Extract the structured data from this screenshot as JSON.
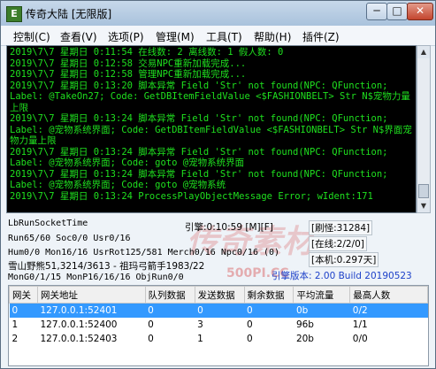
{
  "window": {
    "title": "传奇大陆 [无限版]",
    "icon_name": "app-icon",
    "icon_glyph": "E",
    "minimize_glyph": "─",
    "maximize_glyph": "□",
    "close_glyph": "✕"
  },
  "menu": [
    "控制(C)",
    "查看(V)",
    "选项(P)",
    "管理(M)",
    "工具(T)",
    "帮助(H)",
    "插件(Z)"
  ],
  "log_lines": [
    "2019\\7\\7 星期日 0:11:54 在线数: 2 离线数: 1 假人数: 0",
    "2019\\7\\7 星期日 0:12:58 交易NPC重新加载完成...",
    "2019\\7\\7 星期日 0:12:58 管理NPC重新加载完成...",
    "2019\\7\\7 星期日 0:13:20 脚本异常 Field 'Str' not found(NPC: QFunction;",
    "Label: @TakeOn27; Code: GetDBItemFieldValue <$FASHIONBELT> Str N$宠物力量上限",
    "2019\\7\\7 星期日 0:13:24 脚本异常 Field 'Str' not found(NPC: QFunction;",
    "Label: @宠物系统界面; Code: GetDBItemFieldValue <$FASHIONBELT> Str N$界面宠物力量上限",
    "2019\\7\\7 星期日 0:13:24 脚本异常 Field 'Str' not found(NPC: QFunction;",
    "Label: @宠物系统界面; Code: goto @宠物系统界面",
    "2019\\7\\7 星期日 0:13:24 脚本异常 Field 'Str' not found(NPC: QFunction;",
    "Label: @宠物系统界面; Code: goto @宠物系统",
    "2019\\7\\7 星期日 0:13:24 ProcessPlayObjectMessage Error; wIdent:171"
  ],
  "stats": {
    "run_socket": "LbRunSocketTime",
    "engine": "引擎:0:10:59 [M][F]",
    "refresh": "[刷怪:31284]",
    "run_line": "Run65/60 Soc0/0 Usr0/16",
    "online": "[在线:2/2/0]",
    "hum_line": "Hum0/0 Mon16/16 UsrRot125/581 Merch0/16 Npc0/16 (0)",
    "version": "[本机:0.297天]",
    "player_line": "雪山野熊51,3214/3613 - 祖玛弓箭手1983/22",
    "mong_line": "MonG0/1/15 MonP16/16/16 ObjRun0/0",
    "build": "引擎版本: 2.00 Build 20190523"
  },
  "watermark": {
    "text": "传奇素材",
    "site": "500PI.CC"
  },
  "table": {
    "columns": [
      "网关",
      "网关地址",
      "队列数据",
      "发送数据",
      "剩余数据",
      "平均流量",
      "最高人数"
    ],
    "rows": [
      [
        "0",
        "127.0.0.1:52401",
        "0",
        "0",
        "0",
        "0b",
        "0/2"
      ],
      [
        "1",
        "127.0.0.1:52400",
        "0",
        "3",
        "0",
        "96b",
        "1/1"
      ],
      [
        "2",
        "127.0.0.1:52403",
        "0",
        "1",
        "0",
        "20b",
        "0/0"
      ]
    ],
    "selected_row": 0
  }
}
